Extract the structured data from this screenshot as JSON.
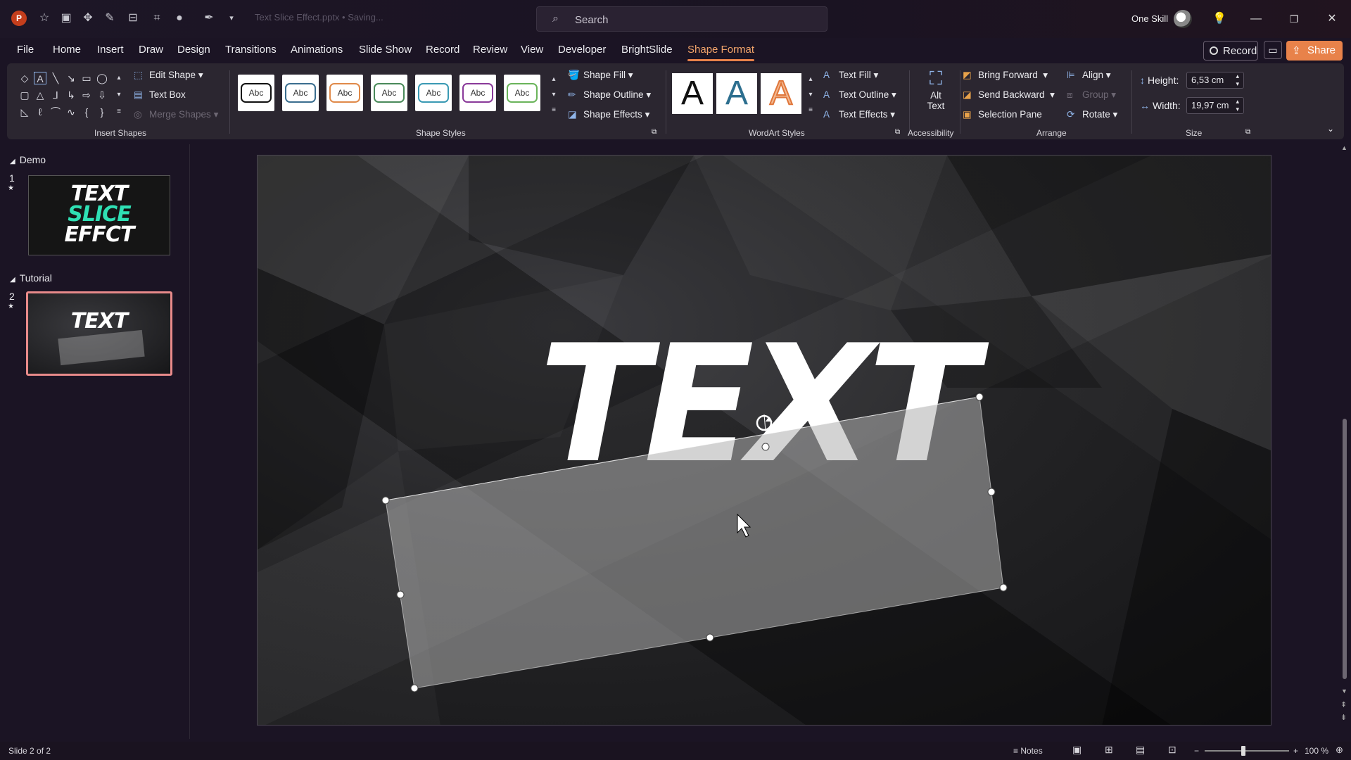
{
  "title_bar": {
    "app_logo": "P",
    "file_title": "Text Slice Effect.pptx • Saving...",
    "search_placeholder": "Search",
    "user_name": "One Skill"
  },
  "tabs": [
    "File",
    "Home",
    "Insert",
    "Draw",
    "Design",
    "Transitions",
    "Animations",
    "Slide Show",
    "Record",
    "Review",
    "View",
    "Developer",
    "BrightSlide",
    "Shape Format"
  ],
  "active_tab": "Shape Format",
  "header_buttons": {
    "record": "Record",
    "share": "Share"
  },
  "ribbon": {
    "insert_shapes": {
      "label": "Insert Shapes",
      "edit_shape": "Edit Shape",
      "text_box": "Text Box",
      "merge_shapes": "Merge Shapes"
    },
    "shape_styles": {
      "label": "Shape Styles",
      "swatch_text": "Abc",
      "shape_fill": "Shape Fill",
      "shape_outline": "Shape Outline",
      "shape_effects": "Shape Effects"
    },
    "wordart_styles": {
      "label": "WordArt Styles",
      "swatch_letter": "A",
      "text_fill": "Text Fill",
      "text_outline": "Text Outline",
      "text_effects": "Text Effects"
    },
    "accessibility": {
      "label": "Accessibility",
      "alt_text_line1": "Alt",
      "alt_text_line2": "Text"
    },
    "arrange": {
      "label": "Arrange",
      "bring_forward": "Bring Forward",
      "send_backward": "Send Backward",
      "selection_pane": "Selection Pane",
      "align": "Align",
      "group": "Group",
      "rotate": "Rotate"
    },
    "size": {
      "label": "Size",
      "height_label": "Height:",
      "height_value": "6,53 cm",
      "width_label": "Width:",
      "width_value": "19,97 cm"
    }
  },
  "slides_panel": {
    "sections": [
      {
        "name": "Demo",
        "slide_number": "1",
        "thumb_lines": [
          "TEXT",
          "SLICE",
          "EFFCT"
        ]
      },
      {
        "name": "Tutorial",
        "slide_number": "2",
        "thumb_lines": [
          "TEXT"
        ]
      }
    ]
  },
  "slide": {
    "main_text": "TEXT"
  },
  "status_bar": {
    "slide_info": "Slide 2 of 2",
    "notes": "Notes",
    "zoom": "100 %"
  },
  "colors": {
    "accent": "#e8824a",
    "active_tab": "#f0a36a",
    "thumb_slice_green": "#2fe0b4",
    "thumb_selected_border": "#e88a8a"
  }
}
